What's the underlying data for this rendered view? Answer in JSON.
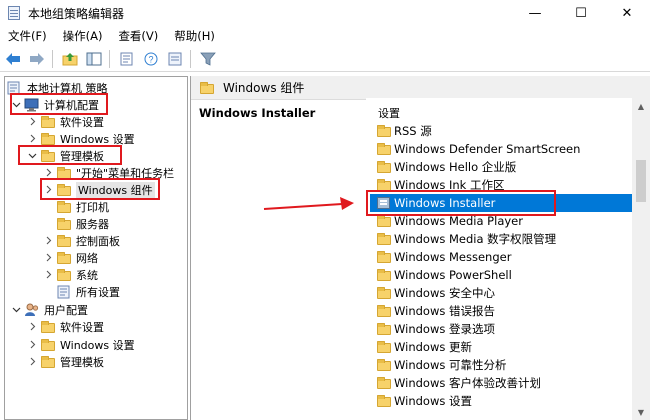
{
  "window": {
    "title": "本地组策略编辑器",
    "minimize": "—",
    "maximize": "☐",
    "close": "✕"
  },
  "menu": [
    "文件(F)",
    "操作(A)",
    "查看(V)",
    "帮助(H)"
  ],
  "toolbar": {
    "icons": [
      "back-icon",
      "forward-icon",
      "up-folder-icon",
      "show-tree-icon",
      "export-icon",
      "help-icon",
      "properties-icon",
      "filter-icon"
    ]
  },
  "tree": {
    "root": "本地计算机 策略",
    "computer_config": "计算机配置",
    "software_settings": "软件设置",
    "windows_settings": "Windows 设置",
    "admin_templates": "管理模板",
    "start_menu": "\"开始\"菜单和任务栏",
    "windows_components": "Windows 组件",
    "printers": "打印机",
    "server": "服务器",
    "control_panel": "控制面板",
    "network": "网络",
    "system": "系统",
    "all_settings": "所有设置",
    "user_config": "用户配置",
    "user_software_settings": "软件设置",
    "user_windows_settings": "Windows 设置",
    "user_admin_templates": "管理模板"
  },
  "right": {
    "header": "Windows 组件",
    "selected_title": "Windows Installer",
    "column_header": "设置",
    "items": [
      "RSS 源",
      "Windows Defender SmartScreen",
      "Windows Hello 企业版",
      "Windows Ink 工作区",
      "Windows Installer",
      "Windows Media Player",
      "Windows Media 数字权限管理",
      "Windows Messenger",
      "Windows PowerShell",
      "Windows 安全中心",
      "Windows 错误报告",
      "Windows 登录选项",
      "Windows 更新",
      "Windows 可靠性分析",
      "Windows 客户体验改善计划",
      "Windows 设置"
    ]
  },
  "colors": {
    "selection": "#0078d7",
    "highlight_box": "#e0191e",
    "folder": "#f7d26a"
  }
}
